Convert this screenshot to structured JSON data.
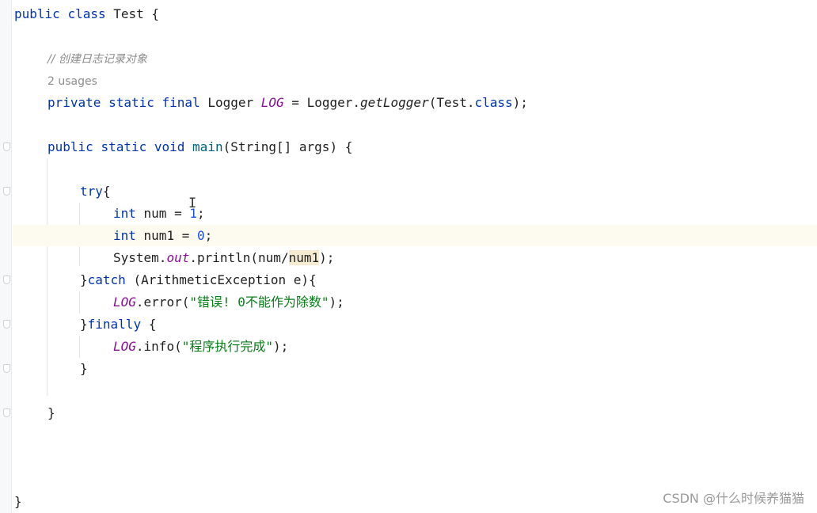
{
  "code": {
    "class_decl": {
      "kw_public": "public",
      "kw_class": "class",
      "name": "Test",
      "brace": " {"
    },
    "comment": "// 创建日志记录对象",
    "usages_hint": "2 usages",
    "field_decl": {
      "kw_private": "private",
      "kw_static": "static",
      "kw_final": "final",
      "type": "Logger",
      "name": "LOG",
      "assign": " = Logger.",
      "method": "getLogger",
      "args_open": "(Test.",
      "kw_class": "class",
      "args_close": ");"
    },
    "main_decl": {
      "kw_public": "public",
      "kw_static": "static",
      "kw_void": "void",
      "name": "main",
      "params": "(String[] args) {"
    },
    "try_line": {
      "kw_try": "try",
      "brace": "{"
    },
    "line_num": {
      "kw_int": "int",
      "text": " num = ",
      "value": "1",
      "end": ";"
    },
    "line_num1": {
      "kw_int": "int",
      "text": " num1 = ",
      "value": "0",
      "end": ";"
    },
    "line_print": {
      "prefix": "System.",
      "field": "out",
      "middle": ".println(num/",
      "ident": "num1",
      "end": ");"
    },
    "catch_line": {
      "close": "}",
      "kw_catch": "catch",
      "rest": " (ArithmeticException e){"
    },
    "error_line": {
      "field": "LOG",
      "call": ".error(",
      "string": "\"错误! 0不能作为除数\"",
      "end": ");"
    },
    "finally_line": {
      "close": "}",
      "kw_finally": "finally",
      "brace": " {"
    },
    "info_line": {
      "field": "LOG",
      "call": ".info(",
      "string": "\"程序执行完成\"",
      "end": ");"
    },
    "close_try": "}",
    "close_main": "}",
    "close_class": "}"
  },
  "watermark": "CSDN @什么时候养猫猫",
  "colors": {
    "keyword": "#0033b3",
    "method_decl": "#00627a",
    "number": "#1750eb",
    "string": "#067d17",
    "static_field": "#871094",
    "comment": "#8c8c8c"
  }
}
